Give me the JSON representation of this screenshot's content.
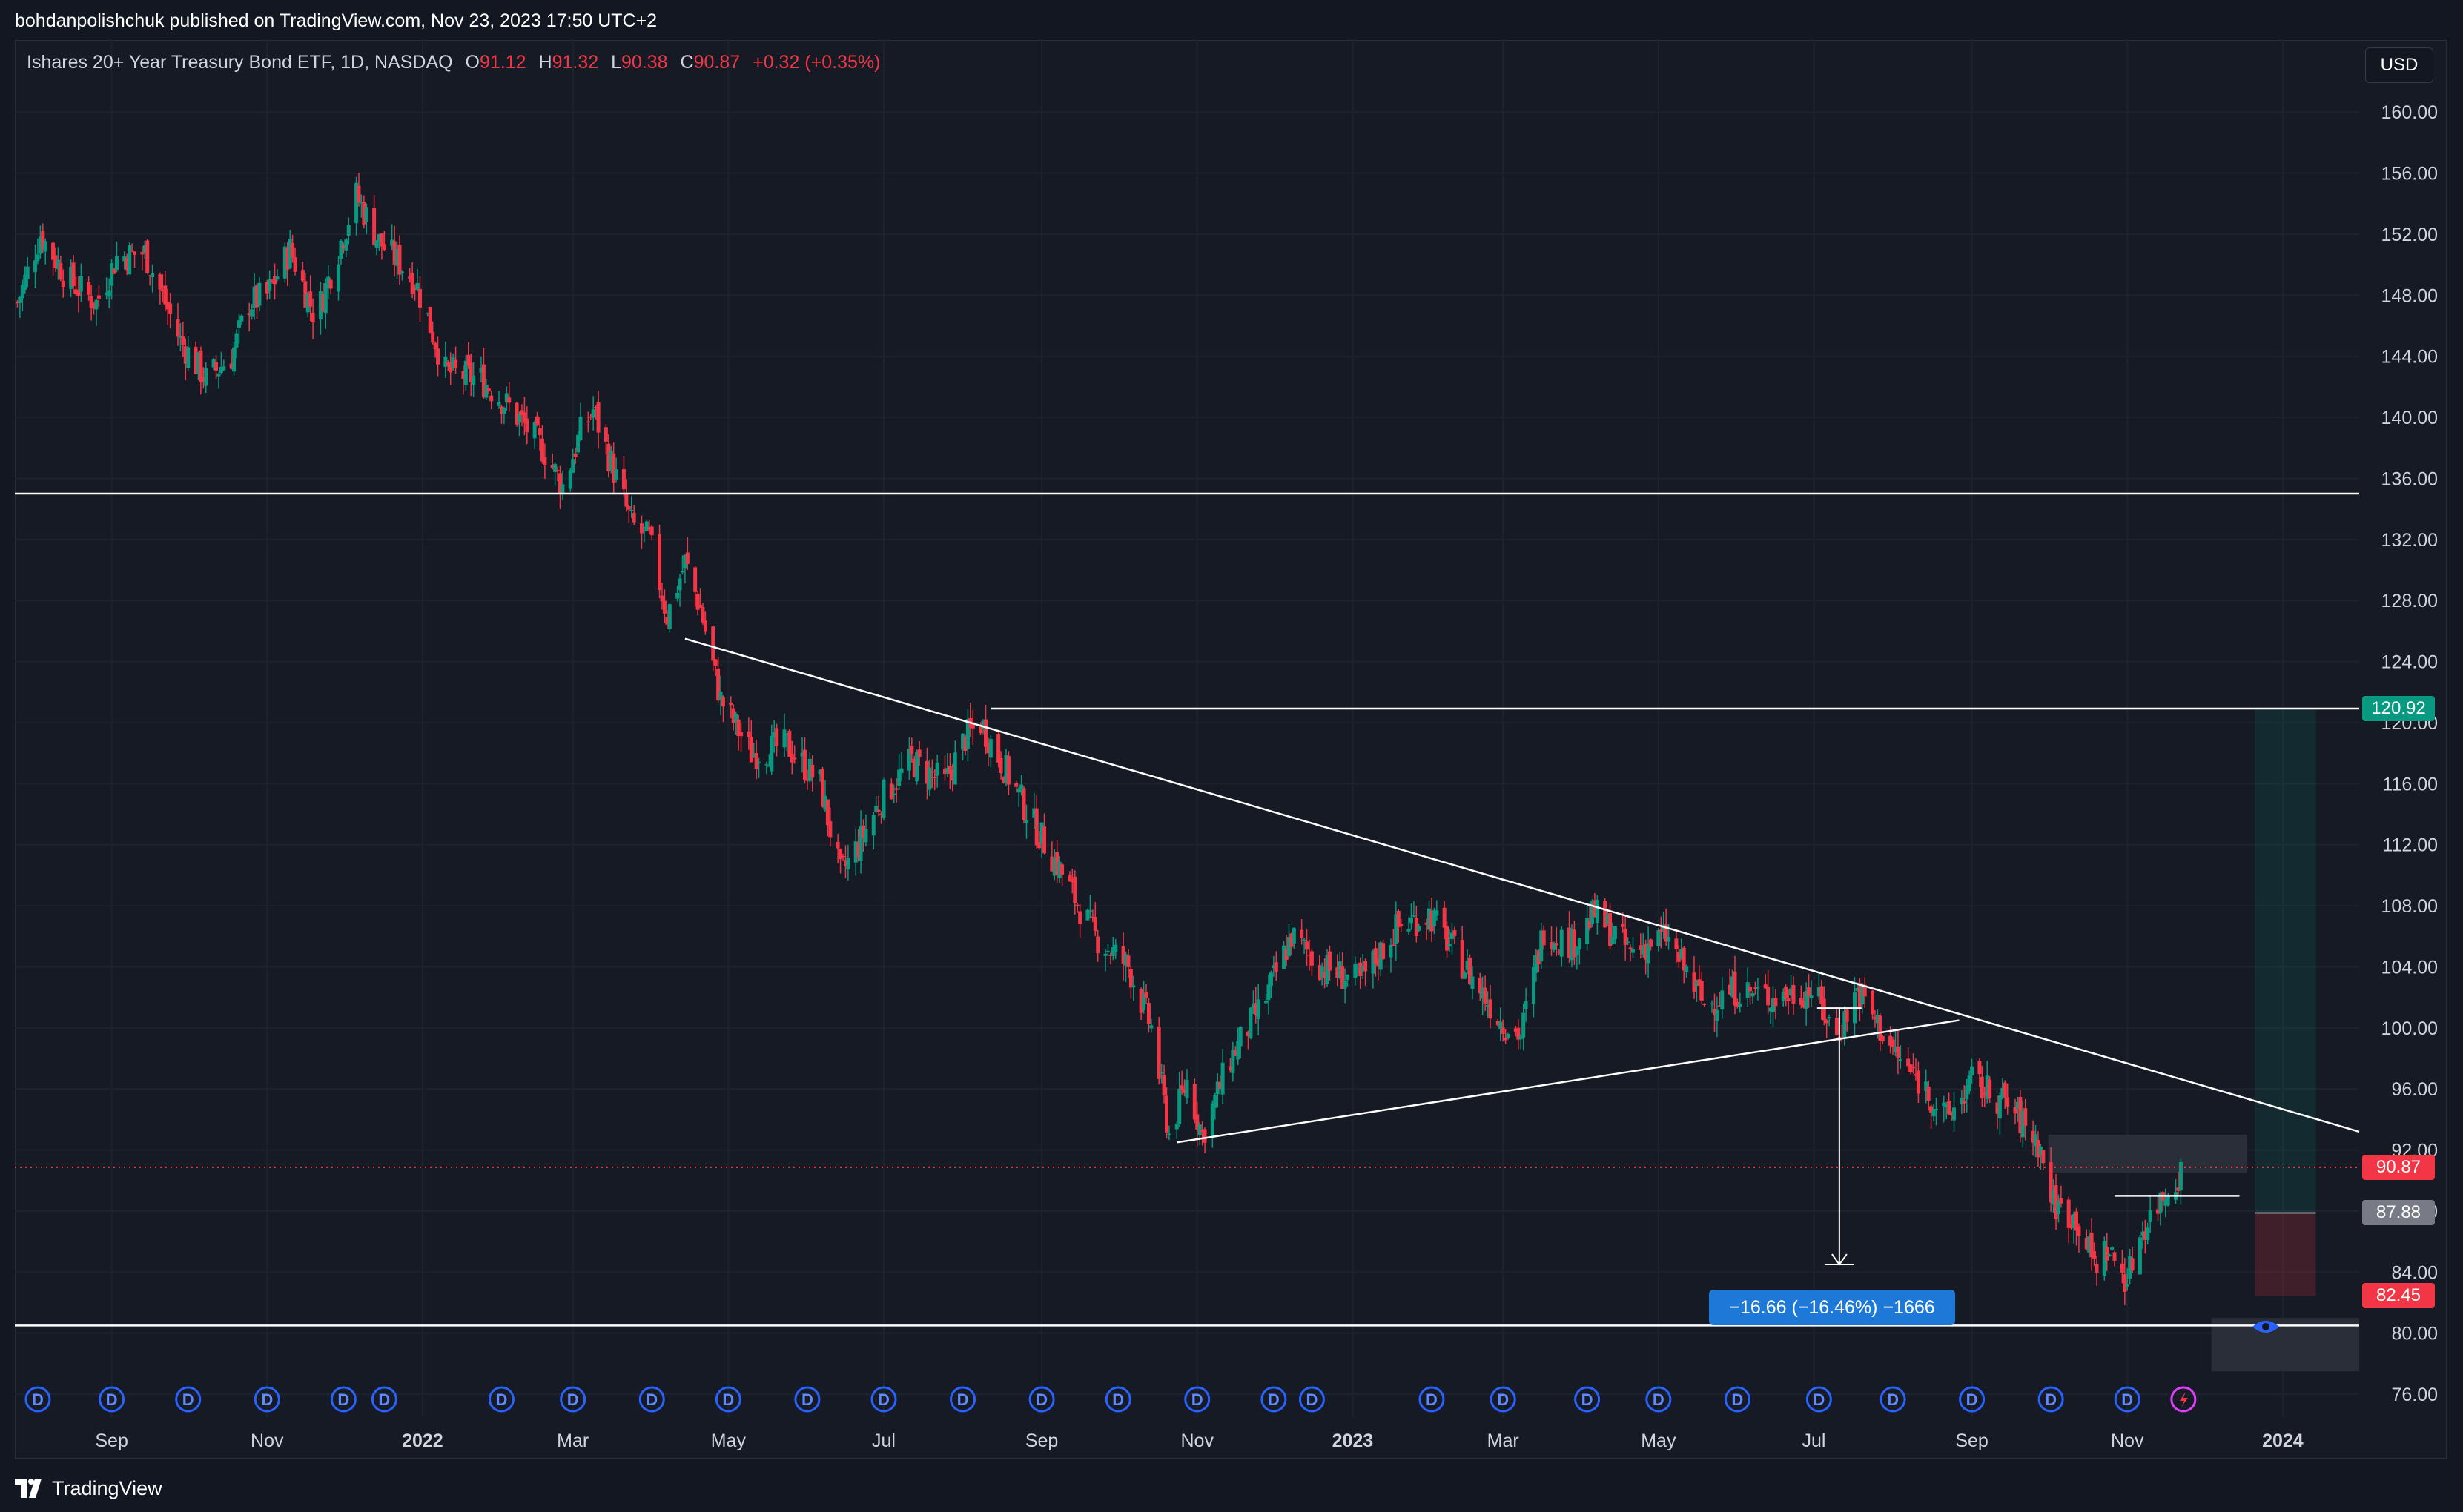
{
  "publisher": "bohdanpolishchuk published on TradingView.com, Nov 23, 2023 17:50 UTC+2",
  "legend": {
    "symbol": "Ishares 20+ Year Treasury Bond ETF, 1D, NASDAQ",
    "o_label": "O",
    "o_value": "91.12",
    "h_label": "H",
    "h_value": "91.32",
    "l_label": "L",
    "l_value": "90.38",
    "c_label": "C",
    "c_value": "90.87",
    "change": "+0.32 (+0.35%)"
  },
  "currency_button": "USD",
  "footer_brand": "TradingView",
  "measure_label": "−16.66 (−16.46%) −1666",
  "price_tags": [
    {
      "label": "120.92",
      "value": 120.92,
      "color": "#089981"
    },
    {
      "label": "90.87",
      "value": 90.87,
      "color": "#f23645"
    },
    {
      "label": "87.88",
      "value": 87.88,
      "color": "#787b86"
    },
    {
      "label": "82.45",
      "value": 82.45,
      "color": "#f23645"
    }
  ],
  "colors": {
    "up": "#089981",
    "down": "#f23645",
    "background": "#161a25",
    "grid": "#1e222d",
    "lines": "#ffffff"
  },
  "dividend_marker": "D",
  "chart_data": {
    "type": "candlestick",
    "title": "Ishares 20+ Year Treasury Bond ETF, 1D, NASDAQ",
    "ylim": [
      74.5,
      162
    ],
    "y_ticks": [
      76,
      80,
      84,
      88,
      92,
      96,
      100,
      104,
      108,
      112,
      116,
      120,
      124,
      128,
      132,
      136,
      140,
      144,
      148,
      152,
      156,
      160
    ],
    "x_range": [
      "2021-07-25",
      "2024-01-31"
    ],
    "x_ticks": [
      {
        "label": "Sep",
        "date": "2021-09-01",
        "bold": false
      },
      {
        "label": "Nov",
        "date": "2021-11-01",
        "bold": false
      },
      {
        "label": "2022",
        "date": "2022-01-01",
        "bold": true
      },
      {
        "label": "Mar",
        "date": "2022-03-01",
        "bold": false
      },
      {
        "label": "May",
        "date": "2022-05-01",
        "bold": false
      },
      {
        "label": "Jul",
        "date": "2022-07-01",
        "bold": false
      },
      {
        "label": "Sep",
        "date": "2022-09-01",
        "bold": false
      },
      {
        "label": "Nov",
        "date": "2022-11-01",
        "bold": false
      },
      {
        "label": "2023",
        "date": "2023-01-01",
        "bold": true
      },
      {
        "label": "Mar",
        "date": "2023-03-01",
        "bold": false
      },
      {
        "label": "May",
        "date": "2023-05-01",
        "bold": false
      },
      {
        "label": "Jul",
        "date": "2023-07-01",
        "bold": false
      },
      {
        "label": "Sep",
        "date": "2023-09-01",
        "bold": false
      },
      {
        "label": "Nov",
        "date": "2023-11-01",
        "bold": false
      },
      {
        "label": "2024",
        "date": "2024-01-01",
        "bold": true
      }
    ],
    "price_path": [
      [
        "2021-07-26",
        147.5
      ],
      [
        "2021-08-04",
        152.0
      ],
      [
        "2021-08-15",
        149.0
      ],
      [
        "2021-08-26",
        147.5
      ],
      [
        "2021-09-03",
        150.5
      ],
      [
        "2021-09-14",
        150.8
      ],
      [
        "2021-09-28",
        145.0
      ],
      [
        "2021-10-08",
        142.5
      ],
      [
        "2021-10-18",
        144.0
      ],
      [
        "2021-10-25",
        147.5
      ],
      [
        "2021-11-01",
        148.0
      ],
      [
        "2021-11-10",
        151.0
      ],
      [
        "2021-11-20",
        146.5
      ],
      [
        "2021-12-01",
        152.0
      ],
      [
        "2021-12-06",
        154.5
      ],
      [
        "2021-12-15",
        151.5
      ],
      [
        "2021-12-29",
        149.0
      ],
      [
        "2022-01-10",
        143.0
      ],
      [
        "2022-01-24",
        142.5
      ],
      [
        "2022-02-05",
        140.5
      ],
      [
        "2022-02-17",
        138.0
      ],
      [
        "2022-02-25",
        135.5
      ],
      [
        "2022-03-04",
        139.0
      ],
      [
        "2022-03-09",
        140.5
      ],
      [
        "2022-03-15",
        137.5
      ],
      [
        "2022-03-24",
        133.0
      ],
      [
        "2022-03-31",
        132.0
      ],
      [
        "2022-04-07",
        127.0
      ],
      [
        "2022-04-14",
        130.5
      ],
      [
        "2022-04-20",
        127.5
      ],
      [
        "2022-04-28",
        121.5
      ],
      [
        "2022-05-10",
        118.0
      ],
      [
        "2022-05-24",
        118.5
      ],
      [
        "2022-06-06",
        116.0
      ],
      [
        "2022-06-14",
        110.0
      ],
      [
        "2022-06-21",
        112.0
      ],
      [
        "2022-06-30",
        115.0
      ],
      [
        "2022-07-12",
        117.5
      ],
      [
        "2022-07-25",
        116.0
      ],
      [
        "2022-08-02",
        119.0
      ],
      [
        "2022-08-08",
        120.0
      ],
      [
        "2022-08-19",
        116.5
      ],
      [
        "2022-08-30",
        113.0
      ],
      [
        "2022-09-06",
        111.0
      ],
      [
        "2022-09-22",
        106.0
      ],
      [
        "2022-10-05",
        104.0
      ],
      [
        "2022-10-14",
        100.0
      ],
      [
        "2022-10-21",
        93.0
      ],
      [
        "2022-10-28",
        96.5
      ],
      [
        "2022-11-03",
        93.0
      ],
      [
        "2022-11-14",
        98.0
      ],
      [
        "2022-11-28",
        102.0
      ],
      [
        "2022-12-08",
        106.0
      ],
      [
        "2022-12-20",
        104.0
      ],
      [
        "2023-01-04",
        103.0
      ],
      [
        "2023-01-18",
        106.5
      ],
      [
        "2023-01-31",
        107.5
      ],
      [
        "2023-02-14",
        104.0
      ],
      [
        "2023-02-28",
        100.5
      ],
      [
        "2023-03-08",
        99.5
      ],
      [
        "2023-03-17",
        106.5
      ],
      [
        "2023-03-28",
        105.5
      ],
      [
        "2023-04-06",
        107.5
      ],
      [
        "2023-04-20",
        105.0
      ],
      [
        "2023-05-04",
        106.0
      ],
      [
        "2023-05-19",
        101.5
      ],
      [
        "2023-05-31",
        102.5
      ],
      [
        "2023-06-15",
        102.0
      ],
      [
        "2023-06-30",
        102.5
      ],
      [
        "2023-07-10",
        99.5
      ],
      [
        "2023-07-18",
        102.5
      ],
      [
        "2023-08-03",
        98.0
      ],
      [
        "2023-08-14",
        96.0
      ],
      [
        "2023-08-22",
        94.0
      ],
      [
        "2023-09-01",
        96.5
      ],
      [
        "2023-09-15",
        95.0
      ],
      [
        "2023-09-27",
        92.5
      ],
      [
        "2023-10-03",
        88.5
      ],
      [
        "2023-10-12",
        87.5
      ],
      [
        "2023-10-19",
        84.5
      ],
      [
        "2023-10-24",
        85.5
      ],
      [
        "2023-11-01",
        83.5
      ],
      [
        "2023-11-06",
        86.5
      ],
      [
        "2023-11-13",
        88.5
      ],
      [
        "2023-11-23",
        90.87
      ]
    ],
    "horizontal_lines": [
      {
        "y": 135.0,
        "from": "2021-07-25",
        "to": "2024-01-31"
      },
      {
        "y": 120.92,
        "from": "2022-08-12",
        "to": "2024-01-31"
      },
      {
        "y": 80.5,
        "from": "2021-07-25",
        "to": "2024-01-31"
      },
      {
        "y": 89.0,
        "from": "2023-10-27",
        "to": "2023-12-15"
      }
    ],
    "trend_lines": [
      {
        "from": [
          "2022-04-14",
          125.5
        ],
        "to": [
          "2024-01-31",
          93.2
        ]
      },
      {
        "from": [
          "2022-10-24",
          92.5
        ],
        "to": [
          "2023-08-27",
          100.5
        ]
      }
    ],
    "measure": {
      "x": "2023-07-11",
      "from": 101.3,
      "to": 84.5
    },
    "current_price": 90.87,
    "dividend_dates": [
      "2021-08-03",
      "2021-09-01",
      "2021-10-01",
      "2021-11-01",
      "2021-12-01",
      "2021-12-17",
      "2022-02-01",
      "2022-03-01",
      "2022-04-01",
      "2022-05-01",
      "2022-06-01",
      "2022-07-01",
      "2022-08-01",
      "2022-09-01",
      "2022-10-01",
      "2022-11-01",
      "2022-12-01",
      "2022-12-16",
      "2023-02-01",
      "2023-03-01",
      "2023-04-03",
      "2023-05-01",
      "2023-06-01",
      "2023-07-03",
      "2023-08-01",
      "2023-09-01",
      "2023-10-02",
      "2023-11-01"
    ]
  }
}
